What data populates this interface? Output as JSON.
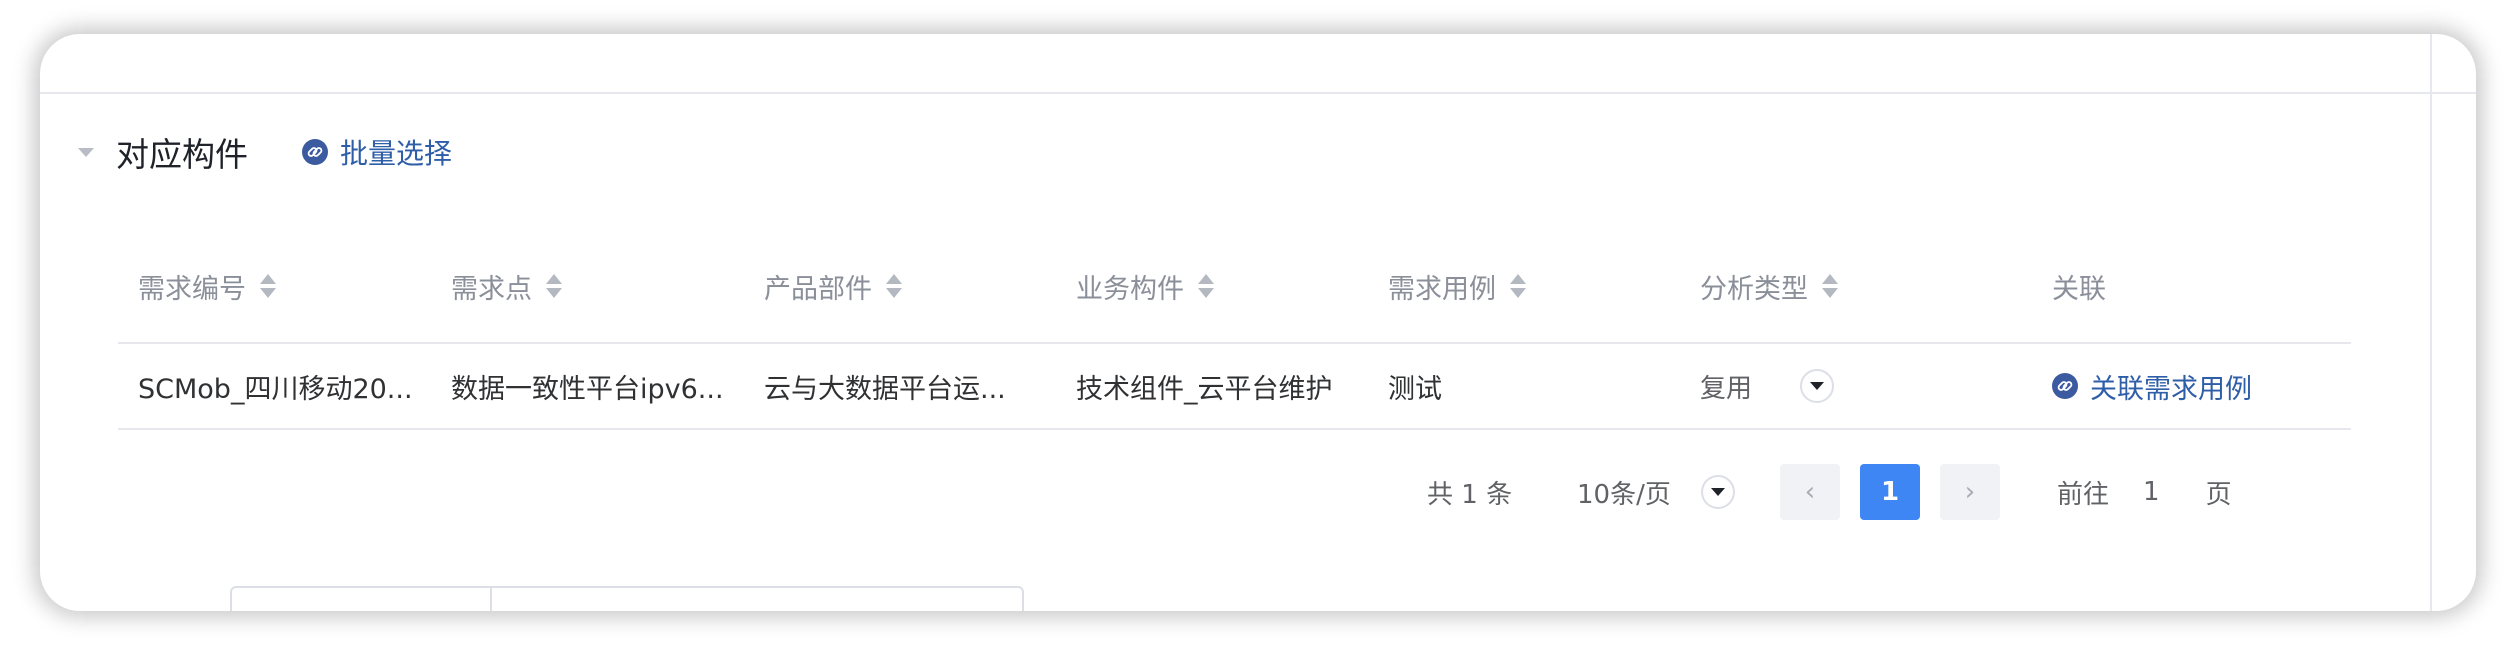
{
  "section": {
    "title": "对应构件",
    "batch_label": "批量选择"
  },
  "table": {
    "columns": [
      "需求编号",
      "需求点",
      "产品部件",
      "业务构件",
      "需求用例",
      "分析类型",
      "关联"
    ],
    "rows": [
      {
        "req_no": "SCMob_四川移动20...",
        "req_point": "数据一致性平台ipv6...",
        "product_part": "云与大数据平台运...",
        "biz_component": "技术组件_云平台维护",
        "use_case": "测试",
        "analysis_type": "复用",
        "relate": "关联需求用例"
      }
    ]
  },
  "pagination": {
    "total": "共 1 条",
    "page_size": "10条/页",
    "prev": "‹",
    "current": "1",
    "next": "›",
    "goto_prefix": "前往",
    "goto_value": "1",
    "goto_suffix": "页"
  },
  "colors": {
    "link": "#2f5ea8",
    "pager_active": "#3d86f4"
  },
  "icons": [
    "caret-down-icon",
    "link-icon",
    "sort-icon",
    "dropdown-arrow-icon"
  ]
}
